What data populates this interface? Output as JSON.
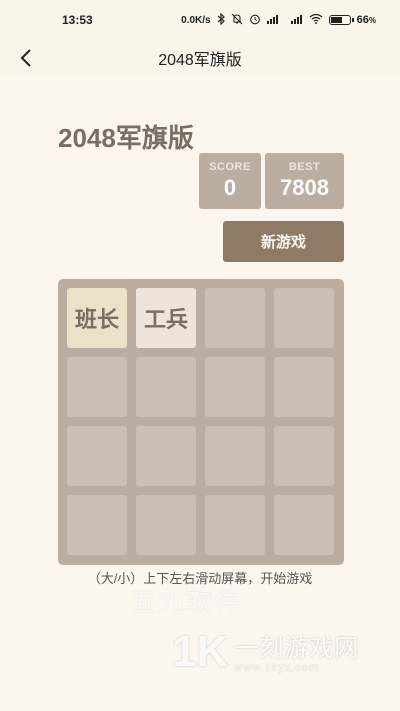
{
  "status_bar": {
    "time": "13:53",
    "net_speed": "0.0K/s",
    "icons": [
      "bluetooth-icon",
      "mute-bell-icon",
      "alarm-icon",
      "signal-icon",
      "hd-signal-icon",
      "wifi-icon",
      "battery-icon"
    ],
    "battery_percent": "66",
    "battery_level": 0.66
  },
  "header": {
    "title": "2048军旗版",
    "back_icon": "chevron-left-icon"
  },
  "game": {
    "title": "2048军旗版",
    "score_label": "SCORE",
    "score_value": "0",
    "best_label": "BEST",
    "best_value": "7808",
    "new_game_label": "新游戏",
    "board": [
      [
        "班长",
        "工兵",
        "",
        ""
      ],
      [
        "",
        "",
        "",
        ""
      ],
      [
        "",
        "",
        "",
        ""
      ],
      [
        "",
        "",
        "",
        ""
      ]
    ],
    "hint": "（大/小）上下左右滑动屏幕，开始游戏"
  },
  "watermarks": {
    "wm1": "五九软件",
    "logo_mark": "1K",
    "logo_cn": "一刻游戏网",
    "logo_url": "www.1kyx.com"
  },
  "colors": {
    "background": "#fcf6ee",
    "board": "#bbada0",
    "button": "#8f7a66",
    "title_text": "#776e65"
  }
}
